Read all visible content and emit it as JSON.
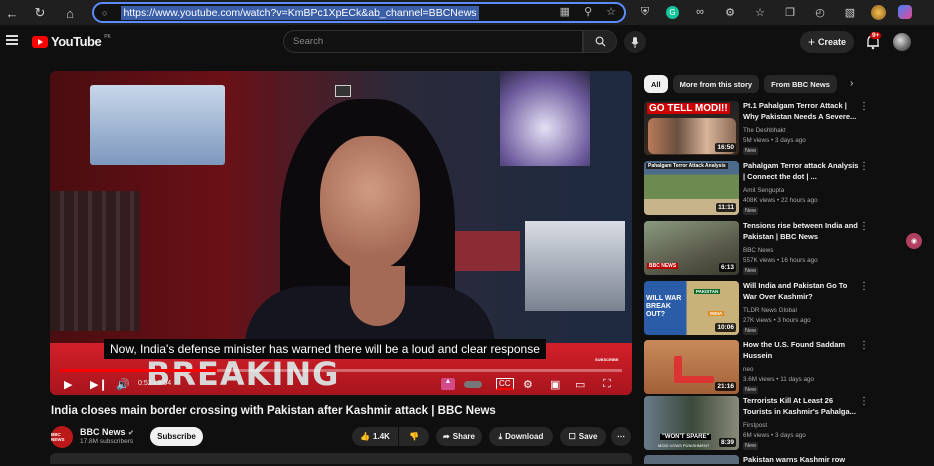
{
  "browser": {
    "url": "https://www.youtube.com/watch?v=KmBPc1XpECk&ab_channel=BBCNews"
  },
  "header": {
    "logo_text": "YouTube",
    "logo_sup": "PK",
    "search_placeholder": "Search",
    "create_label": "Create",
    "notification_count": "9+"
  },
  "player": {
    "caption": "Now, India's defense minister has warned there will be a loud and clear response",
    "breaking_text": "BREAKING",
    "subscribe_tag": "SUBSCRIBE",
    "time": "0:52 / 3:04",
    "progress": 0.28
  },
  "video": {
    "title": "India closes main border crossing with Pakistan after Kashmir attack | BBC News",
    "channel_logo": "BBC NEWS",
    "channel_name": "BBC News",
    "subscribers": "17.8M subscribers",
    "subscribe_label": "Subscribe",
    "likes": "1.4K",
    "share_label": "Share",
    "download_label": "Download",
    "save_label": "Save"
  },
  "chips": [
    {
      "label": "All",
      "active": true
    },
    {
      "label": "More from this story",
      "active": false
    },
    {
      "label": "From BBC News",
      "active": false
    }
  ],
  "recommendations": [
    {
      "title": "Pt.1 Pahalgam Terror Attack | Why Pakistan Needs A Severe...",
      "channel": "The Deshbhakt",
      "meta": "5M views • 3 days ago",
      "badge": "New",
      "duration": "16:50",
      "thumb_text": "GO TELL MODI!!"
    },
    {
      "title": "Pahalgam Terror attack Analysis | Connect the dot | ...",
      "channel": "Amit Sengupta",
      "meta": "408K views • 22 hours ago",
      "badge": "New",
      "duration": "11:11",
      "thumb_text": "Pahalgam Terror Attack Analysis"
    },
    {
      "title": "Tensions rise between India and Pakistan | BBC News",
      "channel": "BBC News",
      "meta": "557K views • 16 hours ago",
      "badge": "New",
      "duration": "6:13",
      "thumb_text": "BBC NEWS"
    },
    {
      "title": "Will India and Pakistan Go To War Over Kashmir?",
      "channel": "TLDR News Global",
      "meta": "27K views • 3 hours ago",
      "badge": "New",
      "duration": "10:06",
      "thumb_text": "WILL WAR BREAK OUT?"
    },
    {
      "title": "How the U.S. Found Saddam Hussein",
      "channel": "neo",
      "meta": "3.6M views • 11 days ago",
      "badge": "New",
      "duration": "21:16",
      "thumb_text": ""
    },
    {
      "title": "Terrorists Kill At Least 26 Tourists in Kashmir's Pahalga...",
      "channel": "Firstpost",
      "meta": "6M views • 3 days ago",
      "badge": "New",
      "duration": "8:39",
      "thumb_text": "\"WON'T SPARE\""
    },
    {
      "title": "Pakistan warns Kashmir row",
      "channel": "",
      "meta": "",
      "badge": "",
      "duration": "",
      "thumb_text": ""
    }
  ],
  "thumb_subtexts": {
    "modi_vows": "MODI VOWS PUNISHMENT",
    "pakistan": "PAKISTAN",
    "india": "INDIA"
  }
}
